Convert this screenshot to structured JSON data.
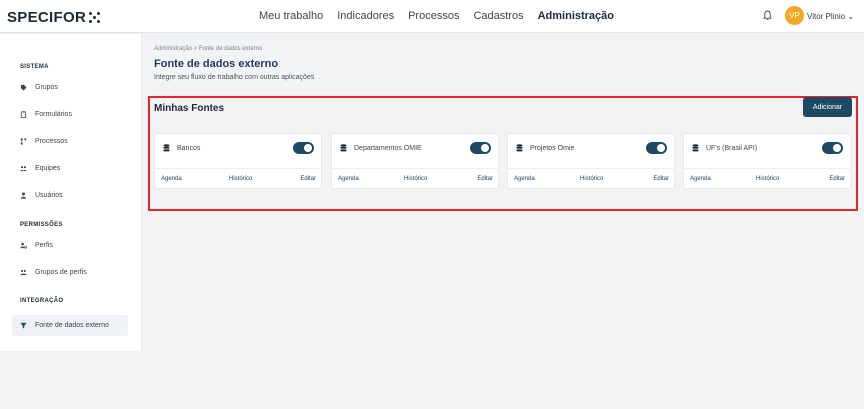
{
  "header": {
    "logo": "SPECIFOR",
    "nav": [
      "Meu trabalho",
      "Indicadores",
      "Processos",
      "Cadastros",
      "Administração"
    ],
    "active_nav": "Administração",
    "avatar_initials": "VP",
    "user_name": "Vitor Plinio"
  },
  "sidebar": {
    "sections": [
      {
        "title": "SISTEMA",
        "items": [
          "Grupos",
          "Formulários",
          "Processos",
          "Equipes",
          "Usuários"
        ]
      },
      {
        "title": "PERMISSÕES",
        "items": [
          "Perfis",
          "Grupos de perfis"
        ]
      },
      {
        "title": "INTEGRAÇÃO",
        "items": [
          "Fonte de dados externo"
        ]
      }
    ]
  },
  "page": {
    "breadcrumb": "Administração  >  Fonte de dados externo",
    "title": "Fonte de dados externo",
    "subtitle": "Integre seu fluxo de trabalho com outras aplicações"
  },
  "panel": {
    "title": "Minhas Fontes",
    "add_label": "Adicionar",
    "cards": [
      {
        "name": "Bancos",
        "enabled": true,
        "links": [
          "Agenda",
          "Histórico",
          "Editar"
        ]
      },
      {
        "name": "Departamentos OMIE",
        "enabled": true,
        "links": [
          "Agenda",
          "Histórico",
          "Editar"
        ]
      },
      {
        "name": "Projetos Omie",
        "enabled": true,
        "links": [
          "Agenda",
          "Histórico",
          "Editar"
        ]
      },
      {
        "name": "UF's (Brasil API)",
        "enabled": true,
        "links": [
          "Agenda",
          "Histórico",
          "Editar"
        ]
      }
    ]
  },
  "colors": {
    "accent": "#1e4b63",
    "highlight": "#e8232a",
    "avatar": "#f5a623"
  }
}
